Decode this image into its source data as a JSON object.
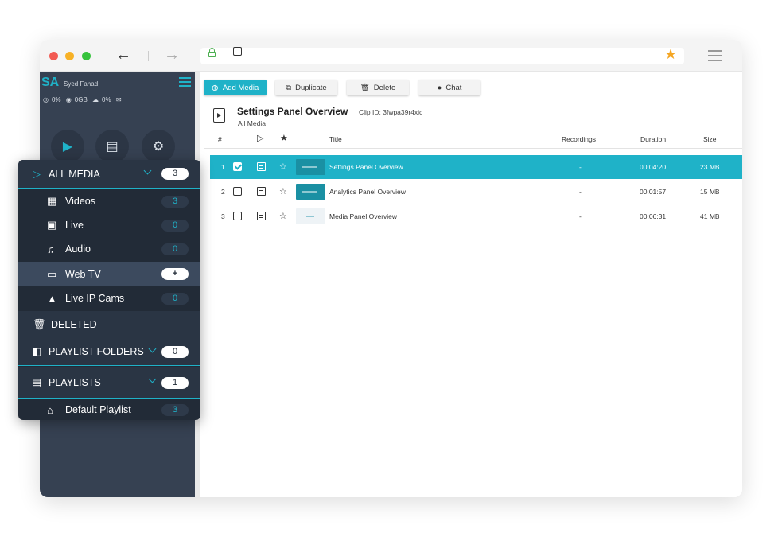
{
  "browser": {
    "url": "",
    "traffic_lights": [
      "#f25a52",
      "#f7b126",
      "#36c33c"
    ]
  },
  "sidebar": {
    "avatar": "SA",
    "username": "Syed Fahad",
    "stats": [
      "0%",
      "0GB",
      "0%"
    ]
  },
  "media_menu": {
    "all_media": {
      "label": "ALL MEDIA",
      "count": "3"
    },
    "items": [
      {
        "label": "Videos",
        "count": "3",
        "icon": "film-icon"
      },
      {
        "label": "Live",
        "count": "0",
        "icon": "video-camera-icon"
      },
      {
        "label": "Audio",
        "count": "0",
        "icon": "music-note-icon"
      },
      {
        "label": "Web TV",
        "count": "+",
        "icon": "tv-icon"
      },
      {
        "label": "Live IP Cams",
        "count": "0",
        "icon": "ip-camera-icon"
      }
    ],
    "deleted": {
      "label": "DELETED"
    },
    "playlist_folders": {
      "label": "PLAYLIST FOLDERS",
      "count": "0"
    },
    "playlists": {
      "label": "PLAYLISTS",
      "count": "1"
    },
    "default_playlist": {
      "label": "Default Playlist",
      "count": "3"
    }
  },
  "toolbar": {
    "add_media": "Add Media",
    "duplicate": "Duplicate",
    "delete": "Delete",
    "chat": "Chat"
  },
  "header": {
    "title": "Settings Panel Overview",
    "clip_id": "Clip ID: 3fwpa39r4xic",
    "subtitle": "All Media"
  },
  "table": {
    "columns": {
      "num": "#",
      "title": "Title",
      "recordings": "Recordings",
      "duration": "Duration",
      "size": "Size"
    },
    "rows": [
      {
        "num": "1",
        "title": "Settings Panel Overview",
        "recordings": "-",
        "duration": "00:04:20",
        "size": "23 MB",
        "selected": true
      },
      {
        "num": "2",
        "title": "Analytics Panel Overview",
        "recordings": "-",
        "duration": "00:01:57",
        "size": "15 MB",
        "selected": false
      },
      {
        "num": "3",
        "title": "Media Panel Overview",
        "recordings": "-",
        "duration": "00:06:31",
        "size": "41 MB",
        "selected": false
      }
    ]
  },
  "colors": {
    "accent": "#1fb2c8",
    "sidebar": "#364152",
    "panel": "#222b37"
  }
}
